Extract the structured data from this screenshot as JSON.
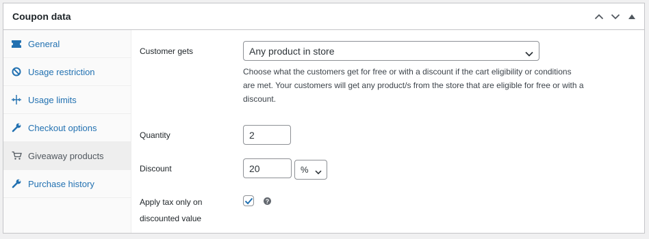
{
  "panel": {
    "title": "Coupon data",
    "actions": [
      "move-up-icon",
      "move-down-icon",
      "toggle-panel-icon"
    ]
  },
  "sidebar": {
    "items": [
      {
        "label": "General",
        "icon": "ticket-icon",
        "active": false
      },
      {
        "label": "Usage restriction",
        "icon": "block-icon",
        "active": false
      },
      {
        "label": "Usage limits",
        "icon": "limits-icon",
        "active": false
      },
      {
        "label": "Checkout options",
        "icon": "wrench-icon",
        "active": false
      },
      {
        "label": "Giveaway products",
        "icon": "cart-icon",
        "active": true
      },
      {
        "label": "Purchase history",
        "icon": "wrench-icon",
        "active": false
      }
    ]
  },
  "fields": {
    "customer_gets": {
      "label": "Customer gets",
      "value": "Any product in store",
      "description": "Choose what the customers get for free or with a discount if the cart eligibility or conditions are met. Your customers will get any product/s from the store that are eligible for free or with a discount."
    },
    "quantity": {
      "label": "Quantity",
      "value": "2"
    },
    "discount": {
      "label": "Discount",
      "value": "20",
      "type": "%"
    },
    "apply_tax": {
      "label_line1": "Apply tax only on",
      "label_line2": "discounted value",
      "checked": true,
      "help": "?"
    }
  },
  "colors": {
    "link": "#2271b1",
    "active_tab_bg": "#eeeeee",
    "border": "#c3c4c7",
    "checkmark": "#2271b1"
  }
}
